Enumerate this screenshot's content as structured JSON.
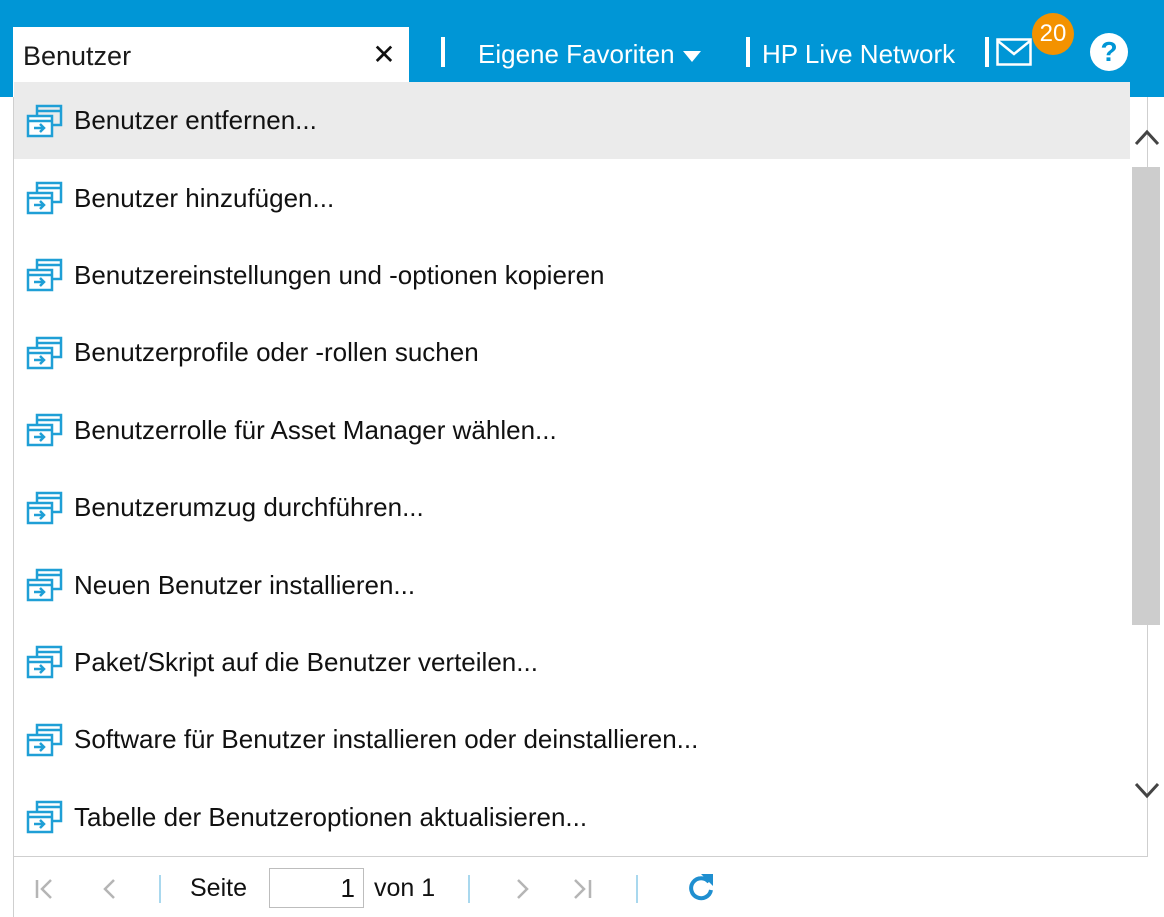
{
  "header": {
    "search": {
      "value": "Benutzer",
      "placeholder": ""
    },
    "clear_label": "✕",
    "favorites_label": "Eigene Favoriten",
    "live_network_label": "HP Live Network",
    "notification_count": "20",
    "help_label": "?"
  },
  "results": {
    "items": [
      {
        "label": "Benutzer entfernen..."
      },
      {
        "label": "Benutzer hinzufügen..."
      },
      {
        "label": "Benutzereinstellungen und -optionen kopieren"
      },
      {
        "label": "Benutzerprofile oder -rollen suchen"
      },
      {
        "label": "Benutzerrolle für Asset Manager wählen..."
      },
      {
        "label": "Benutzerumzug durchführen..."
      },
      {
        "label": "Neuen Benutzer installieren..."
      },
      {
        "label": "Paket/Skript auf die Benutzer verteilen..."
      },
      {
        "label": "Software für Benutzer installieren oder deinstallieren..."
      },
      {
        "label": "Tabelle der Benutzeroptionen aktualisieren..."
      }
    ]
  },
  "pager": {
    "page_label": "Seite",
    "page_value": "1",
    "of_label": "von 1"
  },
  "colors": {
    "header_bg": "#0096d6",
    "badge": "#f39200",
    "highlight_row": "#ebebeb",
    "icon_blue": "#1f9fd6"
  }
}
